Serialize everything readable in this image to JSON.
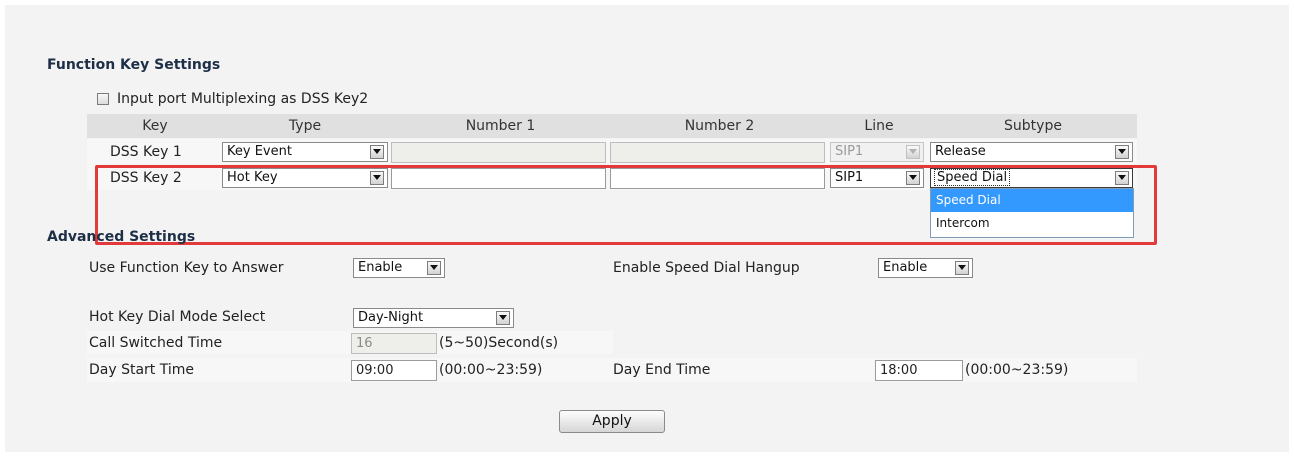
{
  "function_key": {
    "title": "Function Key Settings",
    "multiplex_label": "Input port Multiplexing as DSS Key2",
    "headers": [
      "Key",
      "Type",
      "Number 1",
      "Number 2",
      "Line",
      "Subtype"
    ],
    "rows": [
      {
        "key": "DSS Key 1",
        "type": "Key Event",
        "number1": "",
        "number2": "",
        "line": "SIP1",
        "subtype": "Release"
      },
      {
        "key": "DSS Key 2",
        "type": "Hot Key",
        "number1": "",
        "number2": "",
        "line": "SIP1",
        "subtype": "Speed Dial"
      }
    ],
    "subtype_options": [
      "Speed Dial",
      "Intercom"
    ]
  },
  "advanced": {
    "title": "Advanced Settings",
    "use_fk_answer_label": "Use Function Key to Answer",
    "use_fk_answer_value": "Enable",
    "speed_dial_hangup_label": "Enable Speed Dial Hangup",
    "speed_dial_hangup_value": "Enable",
    "hotkey_mode_label": "Hot Key Dial Mode Select",
    "hotkey_mode_value": "Day-Night",
    "call_switched_label": "Call Switched Time",
    "call_switched_value": "16",
    "call_switched_hint": "(5~50)Second(s)",
    "day_start_label": "Day Start Time",
    "day_start_value": "09:00",
    "day_start_hint": "(00:00~23:59)",
    "day_end_label": "Day End Time",
    "day_end_value": "18:00",
    "day_end_hint": "(00:00~23:59)"
  },
  "apply_label": "Apply",
  "colors": {
    "highlight": "#e23a3a",
    "selected_option": "#3399ff",
    "panel": "#f3f3f3"
  }
}
